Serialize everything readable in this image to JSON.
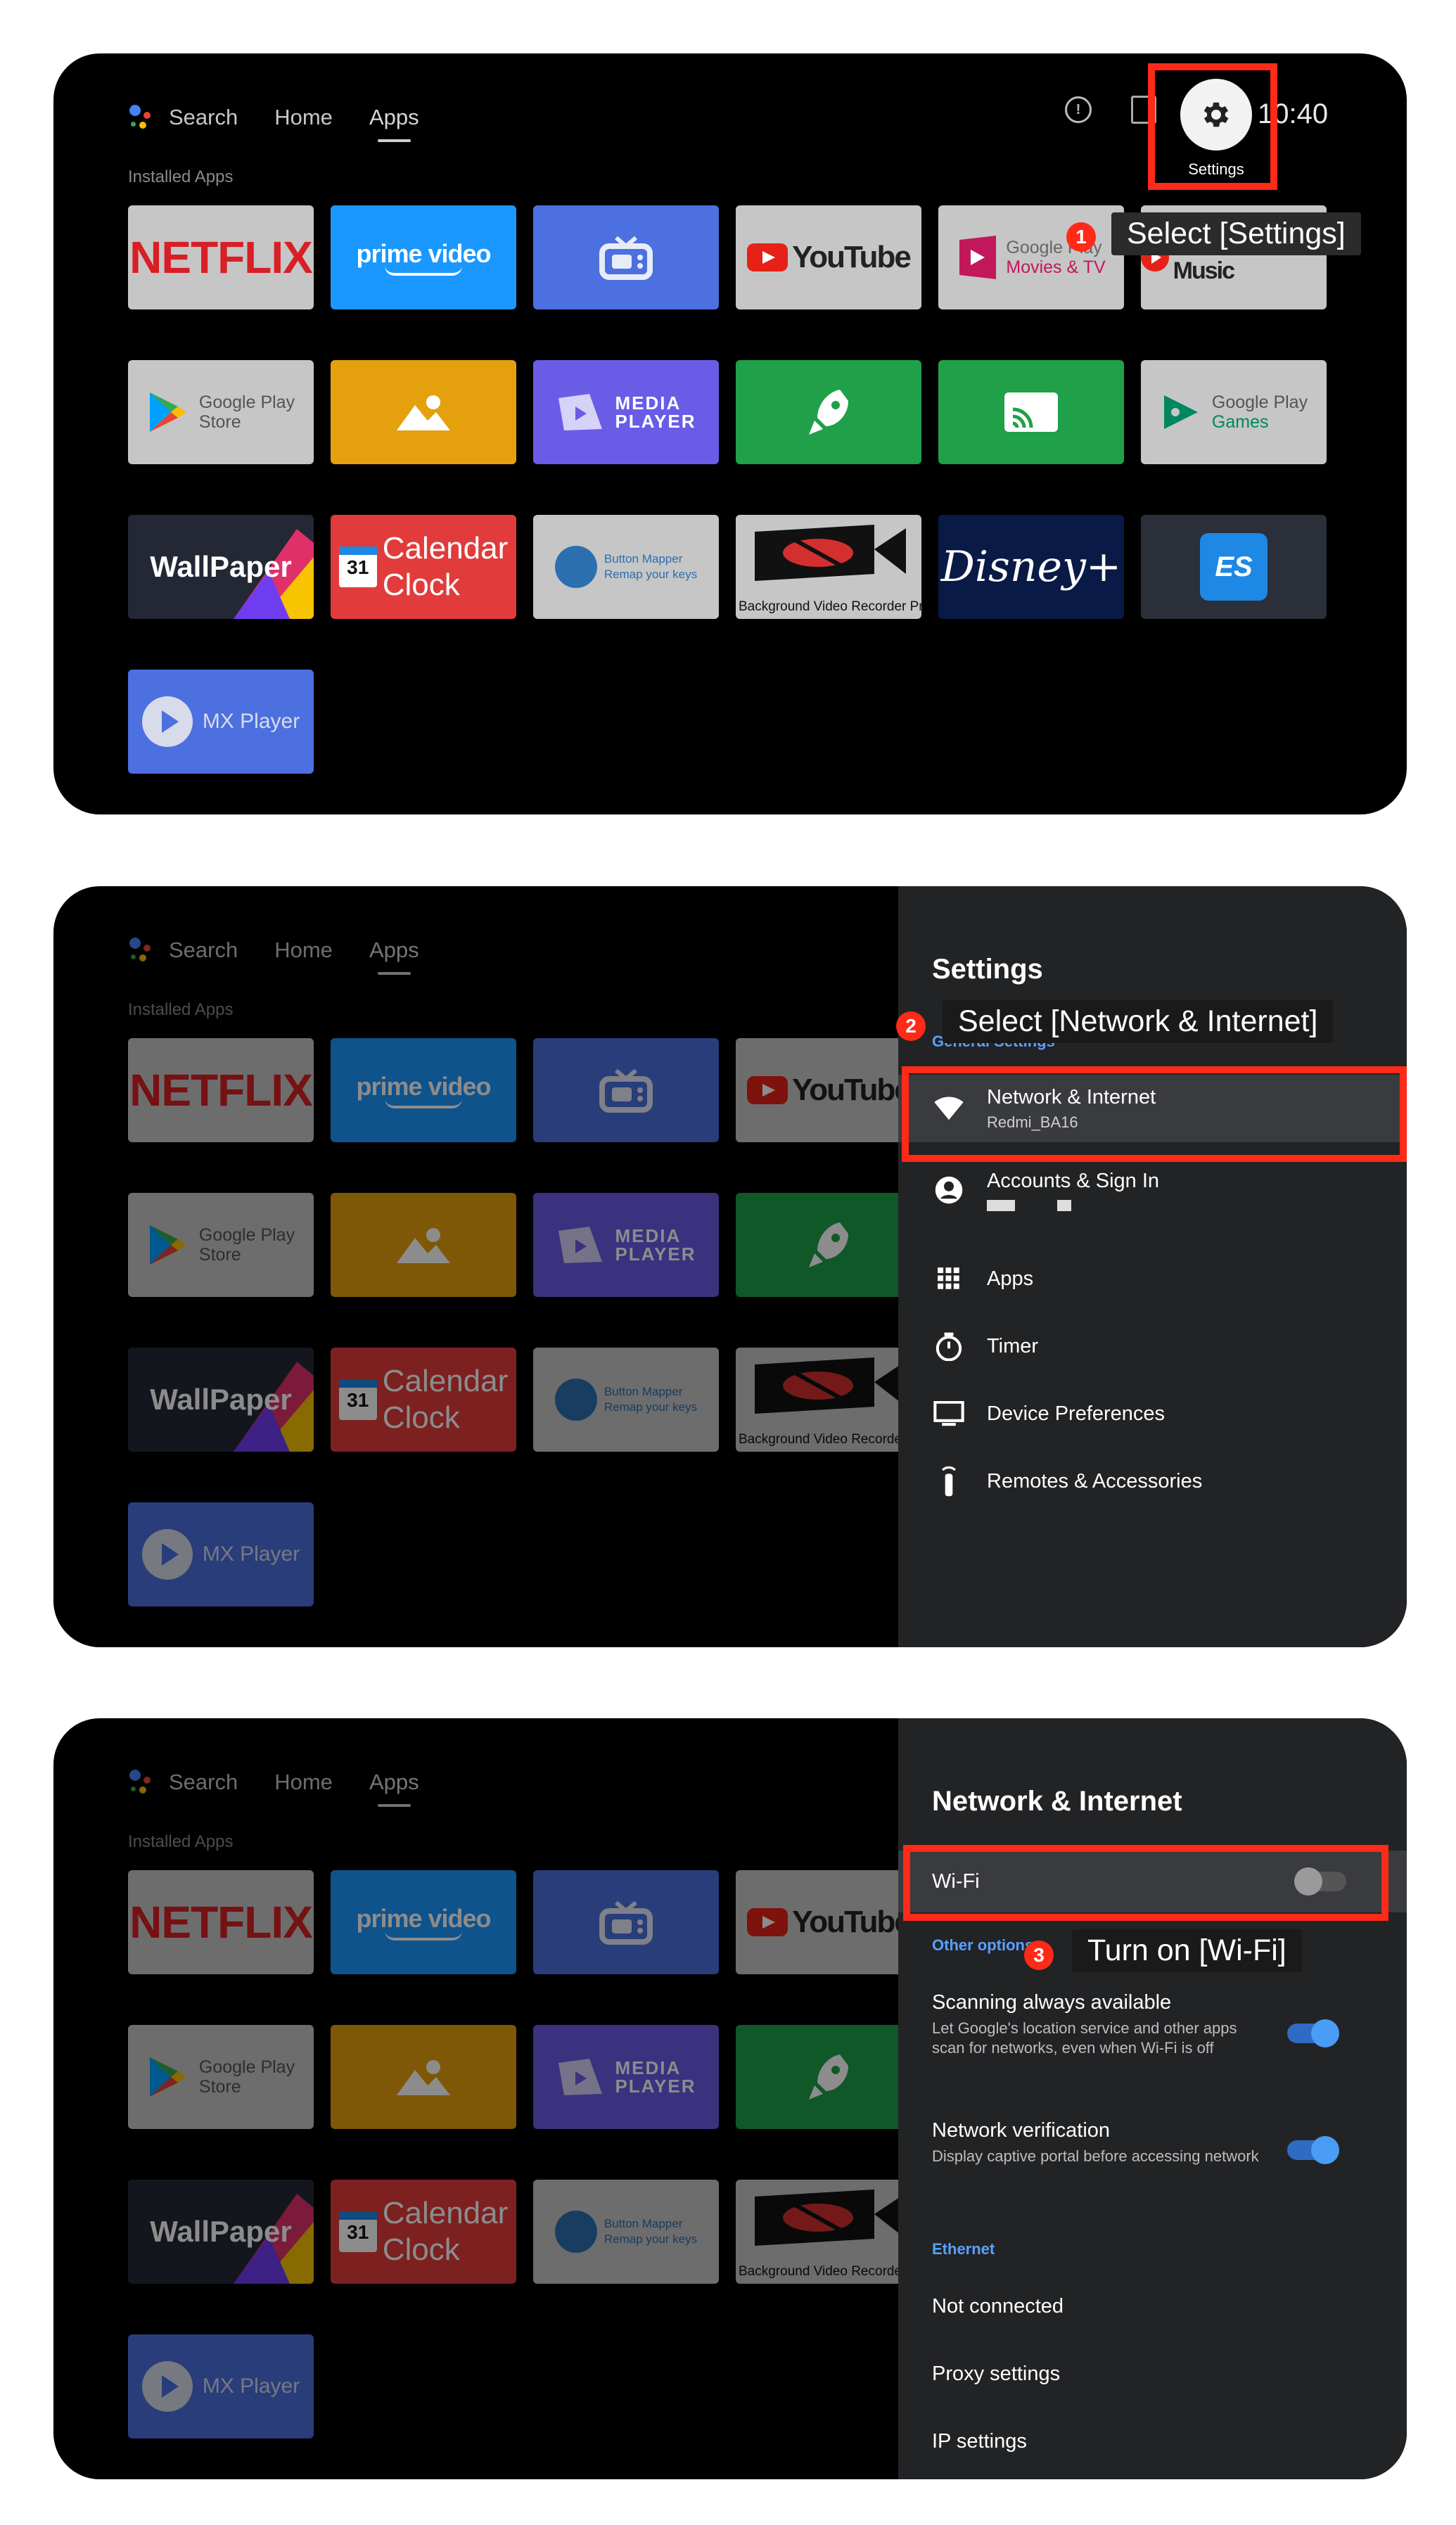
{
  "nav": {
    "search": "Search",
    "home": "Home",
    "apps": "Apps"
  },
  "installed_label": "Installed Apps",
  "apps": {
    "netflix": "NETFLIX",
    "prime_video": "prime video",
    "youtube": "YouTube",
    "google_play_movies": [
      "Google Play",
      "Movies & TV"
    ],
    "youtube_music": "YouTube Music",
    "google_play_store": [
      "Google Play",
      "Store"
    ],
    "media_player": [
      "MEDIA",
      "PLAYER"
    ],
    "google_play_games": [
      "Google Play",
      "Games"
    ],
    "wallpaper": "WallPaper",
    "calendar_clock": [
      "Calendar",
      "Clock"
    ],
    "calendar_day": "31",
    "button_mapper": [
      "Button Mapper",
      "Remap your keys"
    ],
    "bg_video_recorder": "Background Video Recorder Pro",
    "bg_video_recorder_short": "Background Video Recorder",
    "disney": "Disney+",
    "es_label": "ES",
    "mx_player": "MX Player"
  },
  "topbar": {
    "time": "10:40",
    "settings_label": "Settings"
  },
  "steps": {
    "step1": {
      "num": "1",
      "text": "Select [Settings]"
    },
    "step2": {
      "num": "2",
      "text": "Select [Network & Internet]"
    },
    "step3": {
      "num": "3",
      "text": "Turn on [Wi-Fi]"
    }
  },
  "settings_panel": {
    "title": "Settings",
    "section": "General Settings",
    "items": [
      {
        "label": "Network & Internet",
        "sub": "Redmi_BA16",
        "icon": "wifi-icon"
      },
      {
        "label": "Accounts & Sign In",
        "sub": "",
        "icon": "account-icon"
      },
      {
        "label": "Apps",
        "sub": "",
        "icon": "apps-grid-icon"
      },
      {
        "label": "Timer",
        "sub": "",
        "icon": "timer-icon"
      },
      {
        "label": "Device Preferences",
        "sub": "",
        "icon": "tv-icon"
      },
      {
        "label": "Remotes & Accessories",
        "sub": "",
        "icon": "remote-icon"
      }
    ]
  },
  "network_panel": {
    "title": "Network & Internet",
    "wifi_label": "Wi-Fi",
    "wifi_on": false,
    "other_options": "Other options",
    "scanning": {
      "title": "Scanning always available",
      "desc": "Let Google's location service and other apps scan for networks, even when Wi-Fi is off",
      "on": true
    },
    "verification": {
      "title": "Network verification",
      "desc": "Display captive portal before accessing network",
      "on": true
    },
    "ethernet": "Ethernet",
    "not_connected": "Not connected",
    "proxy": "Proxy settings",
    "ip": "IP settings"
  },
  "colors": {
    "highlight_red": "#ff2a17",
    "accent_blue": "#5aa0ff"
  }
}
